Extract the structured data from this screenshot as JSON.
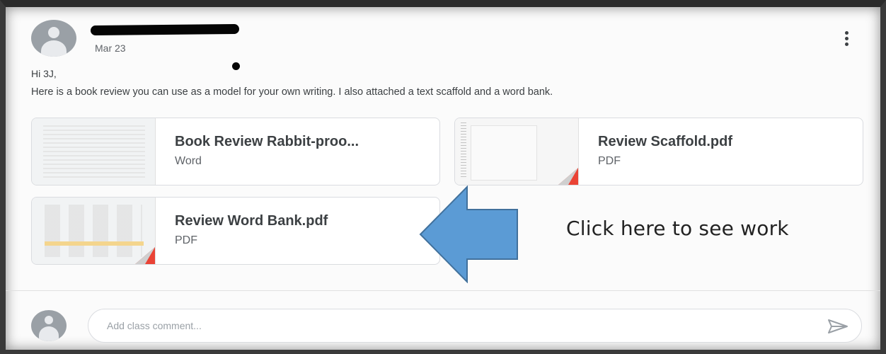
{
  "post": {
    "date": "Mar 23",
    "greeting": "Hi 3J,",
    "message": "Here is a book review you can use as a model for your own writing. I also attached a text scaffold and a word bank."
  },
  "attachments": [
    {
      "title": "Book Review Rabbit-proo...",
      "type": "Word",
      "corner_color": "#2684fc",
      "icon": "word-doc-thumbnail"
    },
    {
      "title": "Review Scaffold.pdf",
      "type": "PDF",
      "corner_color": "#ea4335",
      "icon": "pdf-thumbnail"
    },
    {
      "title": "Review Word Bank.pdf",
      "type": "PDF",
      "corner_color": "#ea4335",
      "icon": "pdf-thumbnail"
    }
  ],
  "annotation": {
    "text": "Click here to see work",
    "arrow_color": "#5b9bd5",
    "arrow_outline": "#41719c",
    "icon": "left-arrow-icon"
  },
  "comment": {
    "placeholder": "Add class comment...",
    "send_icon": "send-icon"
  },
  "icons": {
    "avatar": "user-avatar-icon",
    "menu": "more-vertical-icon"
  }
}
